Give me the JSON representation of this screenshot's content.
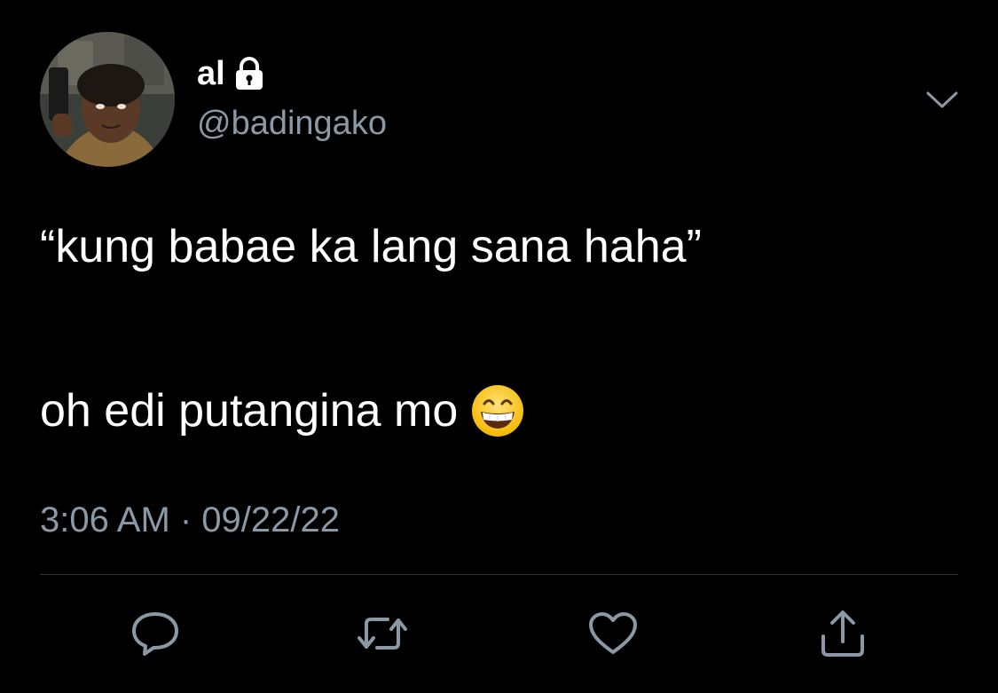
{
  "tweet": {
    "display_name": "al",
    "handle": "@badingako",
    "text_line1": "“kung babae ka lang sana haha”",
    "text_line2": "oh edi putangina mo",
    "timestamp": "3:06 AM · 09/22/22"
  },
  "icons": {
    "lock": "lock-icon",
    "caret": "chevron-down-icon",
    "emoji": "grinning-face-with-smiling-eyes",
    "reply": "reply-icon",
    "retweet": "retweet-icon",
    "like": "heart-icon",
    "share": "share-icon"
  },
  "colors": {
    "background": "#000000",
    "text_primary": "#ffffff",
    "text_secondary": "#8b98a5",
    "divider": "#2f3336"
  }
}
